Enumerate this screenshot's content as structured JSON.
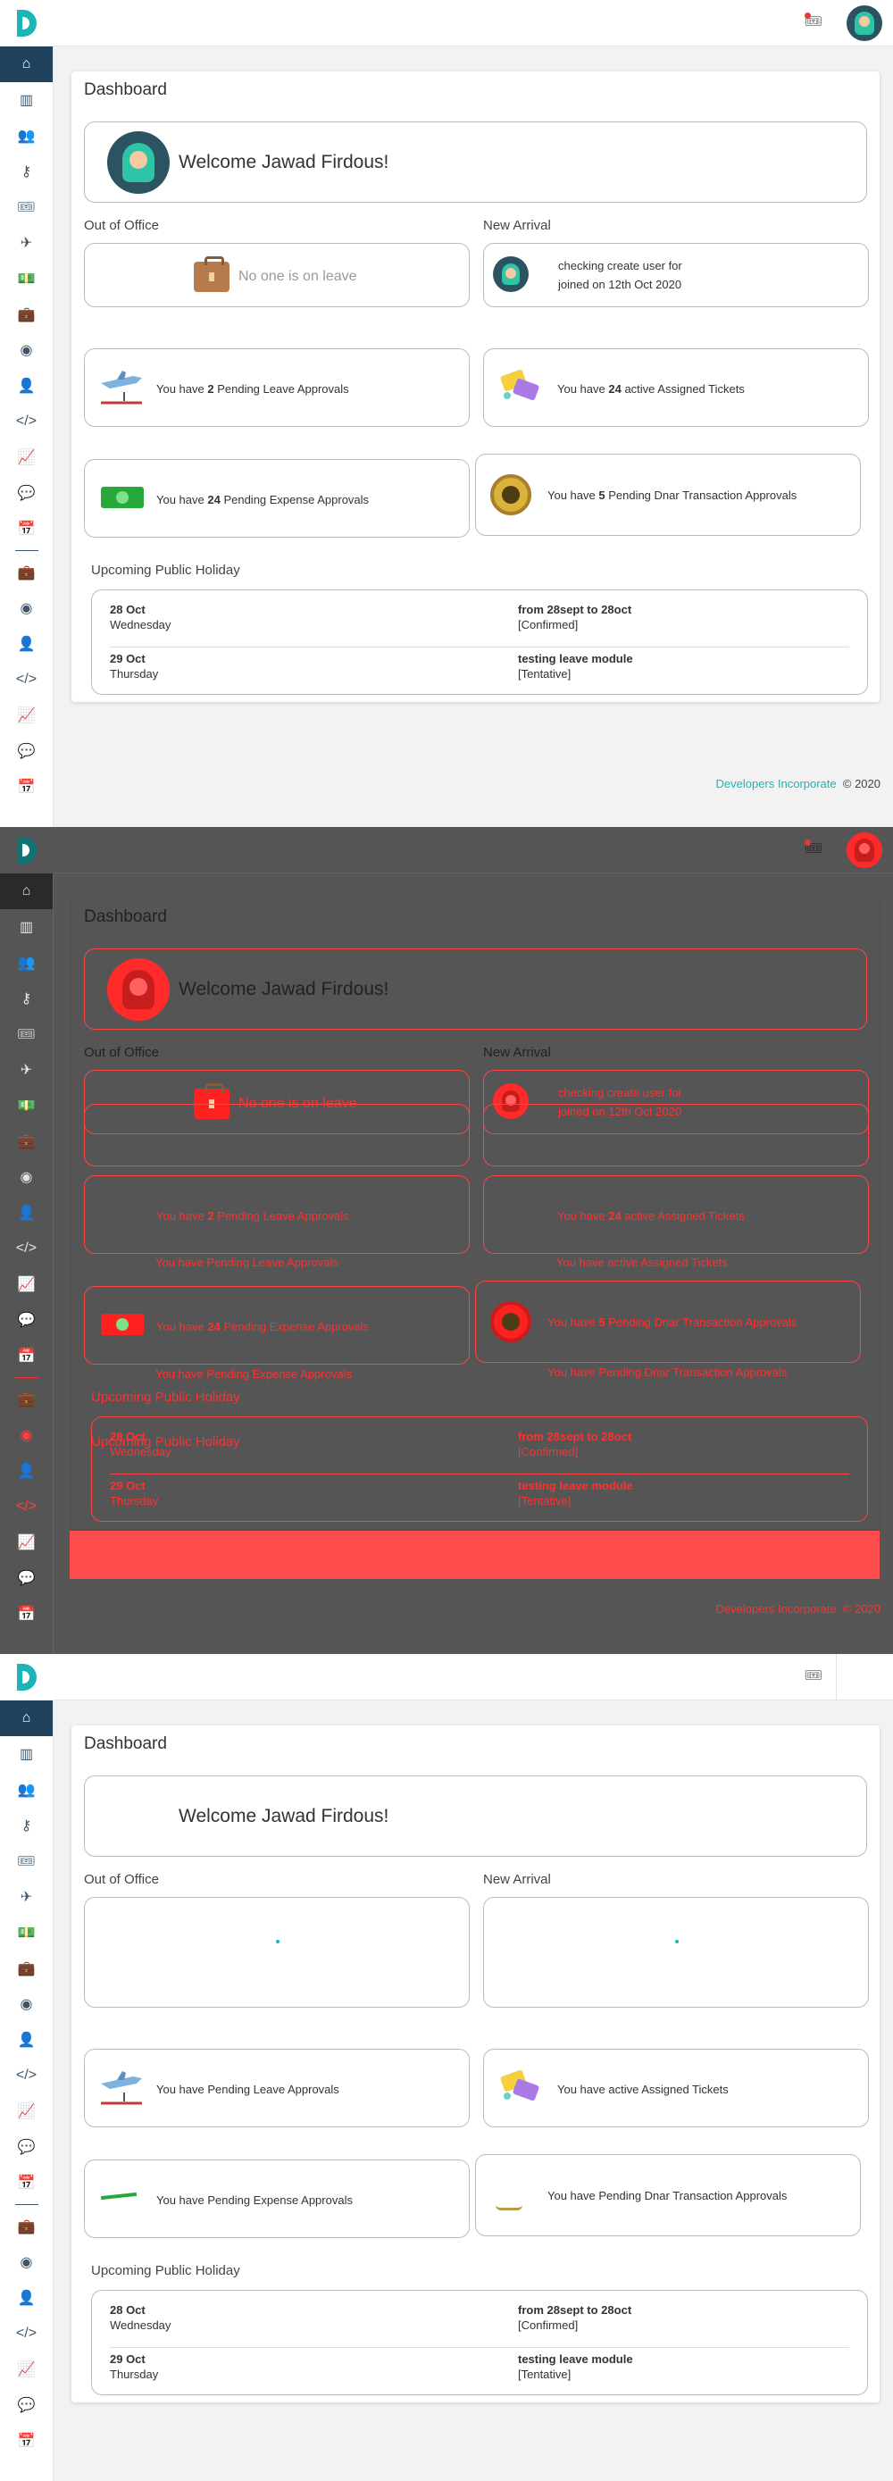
{
  "app": {
    "brand_letter": "D",
    "ticket_icon": "ticket-icon",
    "avatar_icon": "user-avatar"
  },
  "sidebar": {
    "items": [
      {
        "icon": "home-icon",
        "glyph": "⌂"
      },
      {
        "icon": "building-icon",
        "glyph": "▥"
      },
      {
        "icon": "users-icon",
        "glyph": "👥"
      },
      {
        "icon": "key-icon",
        "glyph": "⚷"
      },
      {
        "icon": "ticket-icon",
        "glyph": "🎟"
      },
      {
        "icon": "plane-icon",
        "glyph": "✈"
      },
      {
        "icon": "money-icon",
        "glyph": "💵"
      },
      {
        "icon": "briefcase-icon",
        "glyph": "💼"
      },
      {
        "icon": "coin-icon",
        "glyph": "◉"
      },
      {
        "icon": "user-plus-icon",
        "glyph": "👤"
      },
      {
        "icon": "code-icon",
        "glyph": "</>"
      },
      {
        "icon": "chart-icon",
        "glyph": "📈"
      },
      {
        "icon": "chat-icon",
        "glyph": "💬"
      },
      {
        "icon": "calendar-icon",
        "glyph": "📅"
      },
      {
        "icon": "separator",
        "glyph": ""
      },
      {
        "icon": "briefcase-icon",
        "glyph": "💼"
      },
      {
        "icon": "coin-icon",
        "glyph": "◉"
      },
      {
        "icon": "user-plus-icon",
        "glyph": "👤"
      },
      {
        "icon": "code-icon",
        "glyph": "</>"
      },
      {
        "icon": "chart-icon",
        "glyph": "📈"
      },
      {
        "icon": "chat-icon",
        "glyph": "💬"
      },
      {
        "icon": "calendar-icon",
        "glyph": "📅"
      }
    ]
  },
  "dashboard": {
    "title": "Dashboard",
    "welcome": "Welcome Jawad Firdous!",
    "out_of_office_label": "Out of Office",
    "out_of_office_empty": "No one is on leave",
    "new_arrival_label": "New Arrival",
    "new_arrival_name": "checking create user for",
    "new_arrival_joined": "joined on 12th Oct 2020",
    "leave_approvals": {
      "prefix": "You have ",
      "count": "2",
      "suffix": " Pending Leave Approvals"
    },
    "assigned_tickets": {
      "prefix": "You have ",
      "count": "24",
      "suffix": " active Assigned Tickets"
    },
    "expense_approvals": {
      "prefix": "You have ",
      "count": "24",
      "suffix": " Pending Expense Approvals"
    },
    "dnar_approvals": {
      "prefix": "You have ",
      "count": "5",
      "suffix": " Pending Dnar Transaction Approvals"
    },
    "leave_approvals_nocount": "You have Pending Leave Approvals",
    "assigned_tickets_nocount": "You have active Assigned Tickets",
    "expense_approvals_nocount": "You have Pending Expense Approvals",
    "dnar_approvals_nocount": "You have Pending Dnar Transaction Approvals",
    "holiday_label": "Upcoming Public Holiday",
    "holidays": [
      {
        "date": "28 Oct",
        "day": "Wednesday",
        "name": "from 28sept to 28oct",
        "status": "[Confirmed]"
      },
      {
        "date": "29 Oct",
        "day": "Thursday",
        "name": "testing leave module",
        "status": "[Tentative]"
      }
    ]
  },
  "footer": {
    "brand": "Developers Incorporate",
    "copyright": "© 2020"
  }
}
